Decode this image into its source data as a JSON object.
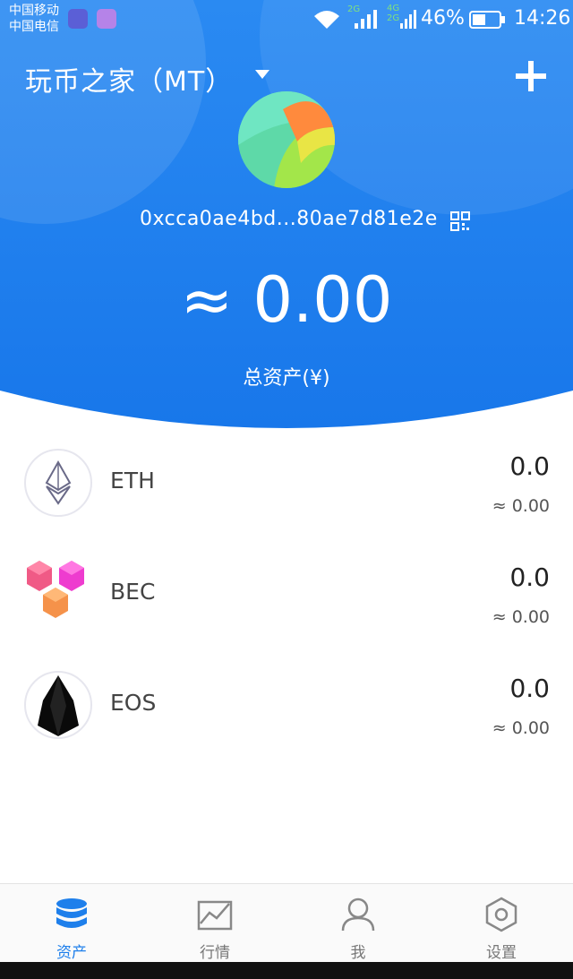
{
  "status_bar": {
    "carrier_1": "中国移动",
    "carrier_2": "中国电信",
    "battery": "46%",
    "time": "14:26",
    "net_2g": "2G",
    "net_4g": "4G",
    "net_2g_b": "2G"
  },
  "header": {
    "wallet_name": "玩币之家（MT）",
    "address": "0xcca0ae4bd...80ae7d81e2e",
    "total_value": "≈ 0.00",
    "total_label": "总资产(¥)"
  },
  "assets": [
    {
      "symbol": "ETH",
      "amount": "0.0",
      "approx": "≈ 0.00",
      "icon": "eth-icon"
    },
    {
      "symbol": "BEC",
      "amount": "0.0",
      "approx": "≈ 0.00",
      "icon": "bec-icon"
    },
    {
      "symbol": "EOS",
      "amount": "0.0",
      "approx": "≈ 0.00",
      "icon": "eos-icon"
    }
  ],
  "tabs": [
    {
      "label": "资产",
      "icon": "assets-icon",
      "active": true
    },
    {
      "label": "行情",
      "icon": "market-chart-icon",
      "active": false
    },
    {
      "label": "我",
      "icon": "profile-icon",
      "active": false
    },
    {
      "label": "设置",
      "icon": "settings-icon",
      "active": false
    }
  ],
  "colors": {
    "primary_blue": "#1E7FEB",
    "header_blue_light": "#3D9BF5",
    "tab_inactive": "#777777"
  }
}
